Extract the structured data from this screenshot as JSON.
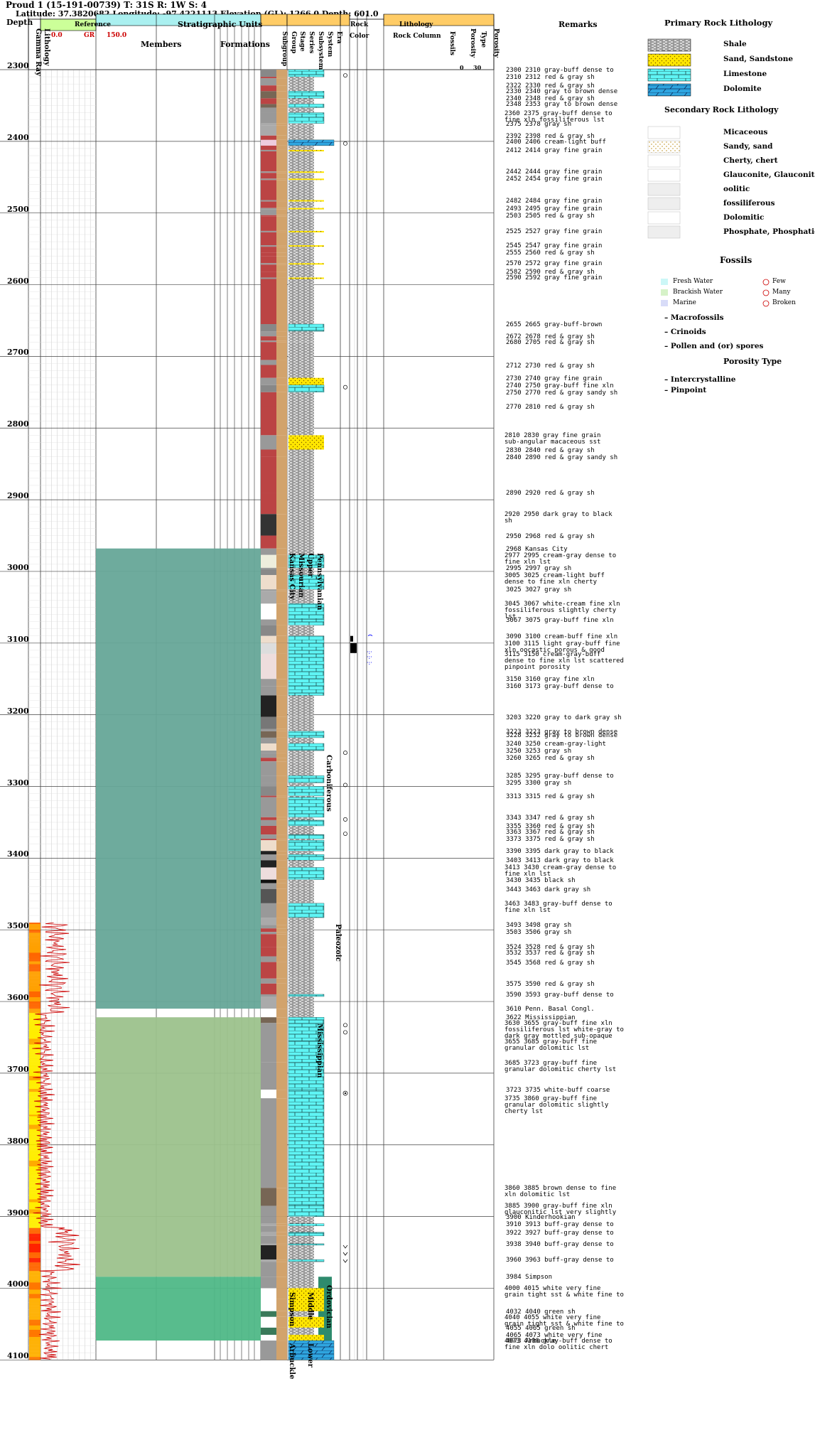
{
  "well": {
    "title": "Proud 1 (15-191-00739) T: 31S R: 1W S: 4",
    "location": "Latitude: 37.3820682 Longitude: -97.4221113 Elevation (GL): 1266.0 Depth: 601.0"
  },
  "headers": {
    "depth": "Depth",
    "lithology": "Lithology",
    "gamma_ray": "Gamma Ray",
    "reference": "Reference",
    "gr_min": "0.0",
    "gr_label": "GR",
    "gr_max": "150.0",
    "strat_units": "Stratigraphic Units",
    "members": "Members",
    "formations": "Formations",
    "subgroup": "Subgroup",
    "group": "Group",
    "stage": "Stage",
    "series": "Series",
    "subsystem": "Subsystem",
    "system": "System",
    "era": "Era",
    "rock_color": "Rock Color",
    "litho": "Lithology",
    "rock_column": "Rock Column",
    "fossils": "Fossils",
    "porosity": "Porosity",
    "type": "Type",
    "porosity2": "Porosity",
    "por_min": "0",
    "por_max": "30",
    "remarks": "Remarks"
  },
  "depth_ticks": [
    "2300",
    "2400",
    "2500",
    "2600",
    "2700",
    "2800",
    "2900",
    "3000",
    "3100",
    "3200",
    "3300",
    "3400",
    "3500",
    "3600",
    "3700",
    "3800",
    "3900",
    "4000",
    "4100"
  ],
  "strat_labels": {
    "kansas_city": "Kansas City",
    "missourian": "Missourian",
    "upper": "Upper",
    "pennsylvanian": "Pennsylvanian",
    "carboniferous": "Carboniferous",
    "paleozoic": "Paleozoic",
    "mississippian": "Mississippian",
    "simpson": "Simpson",
    "middle": "Middle",
    "ordovician": "Ordovician",
    "arbuckle": "Arbuckle",
    "lower": "Lower"
  },
  "remarks": [
    {
      "d": "2300",
      "t": "2300 2310 gray-buff dense to"
    },
    {
      "d": "2310",
      "t": "2310 2312 red & gray sh"
    },
    {
      "d": "2322",
      "t": "2322 2330 red & gray sh"
    },
    {
      "d": "2330",
      "t": "2330 2340 gray to brown dense"
    },
    {
      "d": "2340",
      "t": "2340 2348 red & gray sh"
    },
    {
      "d": "2348",
      "t": "2348 2353 gray to brown dense"
    },
    {
      "d": "2360",
      "t": "2360 2375 gray-buff dense to\nfine xln fossiliferous lst"
    },
    {
      "d": "2375",
      "t": "2375 2378 gray sh"
    },
    {
      "d": "2392",
      "t": "2392 2398 red & gray sh"
    },
    {
      "d": "2400",
      "t": "2400 2406 cream-light buff"
    },
    {
      "d": "2412",
      "t": "2412 2414 gray fine grain"
    },
    {
      "d": "2442",
      "t": "2442 2444 gray fine grain"
    },
    {
      "d": "2452",
      "t": "2452 2454 gray fine grain"
    },
    {
      "d": "2482",
      "t": "2482 2484 gray fine grain"
    },
    {
      "d": "2493",
      "t": "2493 2495 gray fine grain"
    },
    {
      "d": "2503",
      "t": "2503 2505 red & gray sh"
    },
    {
      "d": "2525",
      "t": "2525 2527 gray fine grain"
    },
    {
      "d": "2545",
      "t": "2545 2547 gray fine grain"
    },
    {
      "d": "2555",
      "t": "2555 2560 red & gray sh"
    },
    {
      "d": "2570",
      "t": "2570 2572 gray fine grain"
    },
    {
      "d": "2582",
      "t": "2582 2590 red & gray sh"
    },
    {
      "d": "2590",
      "t": "2590 2592 gray fine grain"
    },
    {
      "d": "2655",
      "t": "2655 2665 gray-buff-brown"
    },
    {
      "d": "2672",
      "t": "2672 2678 red & gray sh"
    },
    {
      "d": "2680",
      "t": "2680 2705 red & gray sh"
    },
    {
      "d": "2712",
      "t": "2712 2730 red & gray sh"
    },
    {
      "d": "2730",
      "t": "2730 2740 gray fine grain"
    },
    {
      "d": "2740",
      "t": "2740 2750 gray-buff fine xln"
    },
    {
      "d": "2750",
      "t": "2750 2770 red & gray sandy sh"
    },
    {
      "d": "2770",
      "t": "2770 2810 red & gray sh"
    },
    {
      "d": "2810",
      "t": "2810 2830 gray fine grain\nsub-angular macaceous sst"
    },
    {
      "d": "2830",
      "t": "2830 2840 red & gray sh"
    },
    {
      "d": "2840",
      "t": "2840 2890 red & gray sandy sh"
    },
    {
      "d": "2890",
      "t": "2890 2920 red & gray sh"
    },
    {
      "d": "2920",
      "t": "2920 2950 dark gray to black\nsh"
    },
    {
      "d": "2950",
      "t": "2950 2968 red & gray sh"
    },
    {
      "d": "2968",
      "t": "2968 Kansas City"
    },
    {
      "d": "2977",
      "t": "2977 2995 cream-gray dense to\nfine xln lst"
    },
    {
      "d": "2995",
      "t": "2995 2997 gray sh"
    },
    {
      "d": "3005",
      "t": "3005 3025 cream-light buff\ndense to fine xln cherty"
    },
    {
      "d": "3025",
      "t": "3025 3027 gray sh"
    },
    {
      "d": "3045",
      "t": "3045 3067 white-cream fine xln\nfossiliferous slightly cherty\nlst"
    },
    {
      "d": "3067",
      "t": "3067 3075 gray-buff fine xln"
    },
    {
      "d": "3090",
      "t": "3090 3100 cream-buff fine xln"
    },
    {
      "d": "3100",
      "t": "3100 3115 light gray-buff fine\nxln oocastic porous & good"
    },
    {
      "d": "3115",
      "t": "3115 3150 cream-gray-buff\ndense to fine xln lst scattered\npinpoint porosity"
    },
    {
      "d": "3150",
      "t": "3150 3160 gray fine xln"
    },
    {
      "d": "3160",
      "t": "3160 3173 gray-buff dense to"
    },
    {
      "d": "3203",
      "t": "3203 3220 gray to dark gray sh"
    },
    {
      "d": "3223",
      "t": "3223 3223 gray to brown dense"
    },
    {
      "d": "3228",
      "t": "3228 3232 gray to brown dense"
    },
    {
      "d": "3240",
      "t": "3240 3250 cream-gray-light"
    },
    {
      "d": "3250",
      "t": "3250 3253 gray sh"
    },
    {
      "d": "3260",
      "t": "3260 3265 red & gray sh"
    },
    {
      "d": "3285",
      "t": "3285 3295 gray-buff dense to"
    },
    {
      "d": "3295",
      "t": "3295 3300 gray sh"
    },
    {
      "d": "3313",
      "t": "3313 3315 red & gray sh"
    },
    {
      "d": "3343",
      "t": "3343 3347 red & gray sh"
    },
    {
      "d": "3355",
      "t": "3355 3360 red & gray sh"
    },
    {
      "d": "3363",
      "t": "3363 3367 red & gray sh"
    },
    {
      "d": "3373",
      "t": "3373 3375 red & gray sh"
    },
    {
      "d": "3390",
      "t": "3390 3395 dark gray to black"
    },
    {
      "d": "3403",
      "t": "3403 3413 dark gray to black"
    },
    {
      "d": "3413",
      "t": "3413 3430 cream-gray dense to\nfine xln lst"
    },
    {
      "d": "3430",
      "t": "3430 3435 black sh"
    },
    {
      "d": "3443",
      "t": "3443 3463 dark gray sh"
    },
    {
      "d": "3463",
      "t": "3463 3483 gray-buff dense to\nfine xln lst"
    },
    {
      "d": "3493",
      "t": "3493 3498 gray sh"
    },
    {
      "d": "3503",
      "t": "3503 3506 gray sh"
    },
    {
      "d": "3524",
      "t": "3524 3528 red & gray sh"
    },
    {
      "d": "3532",
      "t": "3532 3537 red & gray sh"
    },
    {
      "d": "3545",
      "t": "3545 3568 red & gray sh"
    },
    {
      "d": "3575",
      "t": "3575 3590 red & gray sh"
    },
    {
      "d": "3590",
      "t": "3590 3593 gray-buff dense to"
    },
    {
      "d": "3610",
      "t": "3610 Penn. Basal Congl."
    },
    {
      "d": "3622",
      "t": "3622 Mississippian"
    },
    {
      "d": "3630",
      "t": "3630 3655 gray-buff fine xln\nfossiliferous lst white-gray to\ndark gray mottled sub-opaque"
    },
    {
      "d": "3655",
      "t": "3655 3685 gray-buff fine\ngranular dolomitic lst"
    },
    {
      "d": "3685",
      "t": "3685 3723 gray-buff fine\ngranular dolomitic cherty lst"
    },
    {
      "d": "3723",
      "t": "3723 3735 white-buff coarse"
    },
    {
      "d": "3735",
      "t": "3735 3860 gray-buff fine\ngranular dolomitic slightly\ncherty lst"
    },
    {
      "d": "3860",
      "t": "3860 3885 brown dense to fine\nxln dolomitic lst"
    },
    {
      "d": "3885",
      "t": "3885 3900 gray-buff fine xln\nglauconitic lst very slightly"
    },
    {
      "d": "3900",
      "t": "3900 Kinderhookian"
    },
    {
      "d": "3910",
      "t": "3910 3913 buff-gray dense to"
    },
    {
      "d": "3922",
      "t": "3922 3927 buff-gray dense to"
    },
    {
      "d": "3938",
      "t": "3938 3940 buff-gray dense to"
    },
    {
      "d": "3960",
      "t": "3960 3963 buff-gray dense to"
    },
    {
      "d": "3984",
      "t": "3984 Simpson"
    },
    {
      "d": "4000",
      "t": "4000 4015 white very fine\ngrain tight sst & white fine to"
    },
    {
      "d": "4032",
      "t": "4032 4040 green sh"
    },
    {
      "d": "4040",
      "t": "4040 4055 white very fine\ngrain tight sst & white fine to"
    },
    {
      "d": "4055",
      "t": "4055 4065 green sh"
    },
    {
      "d": "4065",
      "t": "4065 4073 white very fine"
    },
    {
      "d": "4073",
      "t": "4073 Arbuckle"
    },
    {
      "d": "4073b",
      "t": "4073 4100 gray-buff dense to\nfine xln dolo oolitic chert"
    }
  ],
  "legend": {
    "primary_title": "Primary Rock Lithology",
    "primary": [
      "Shale",
      "Sand, Sandstone",
      "Limestone",
      "Dolomite"
    ],
    "secondary_title": "Secondary Rock Lithology",
    "secondary": [
      "Micaceous",
      "Sandy, sand",
      "Cherty, chert",
      "Glauconite, Glauconitic",
      "oolitic",
      "fossiliferous",
      "Dolomitic",
      "Phosphate, Phosphatic"
    ],
    "fossils_title": "Fossils",
    "fossil_env": [
      "Fresh Water",
      "Brackish Water",
      "Marine"
    ],
    "fossil_abund": [
      "Few",
      "Many",
      "Broken"
    ],
    "fossil_types": [
      "– Macrofossils",
      "– Crinoids",
      "– Pollen and (or) spores"
    ],
    "porosity_title": "Porosity Type",
    "porosity_types": [
      "– Intercrystalline",
      "– Pinpoint"
    ],
    "colors": {
      "shale": "#b9b9b9",
      "sand": "#ffe600",
      "limestone": "#5ff4f4",
      "dolomite": "#2fa6e0",
      "penn": "#66a698",
      "miss": "#9cc28c",
      "ord": "#4fb887"
    }
  }
}
